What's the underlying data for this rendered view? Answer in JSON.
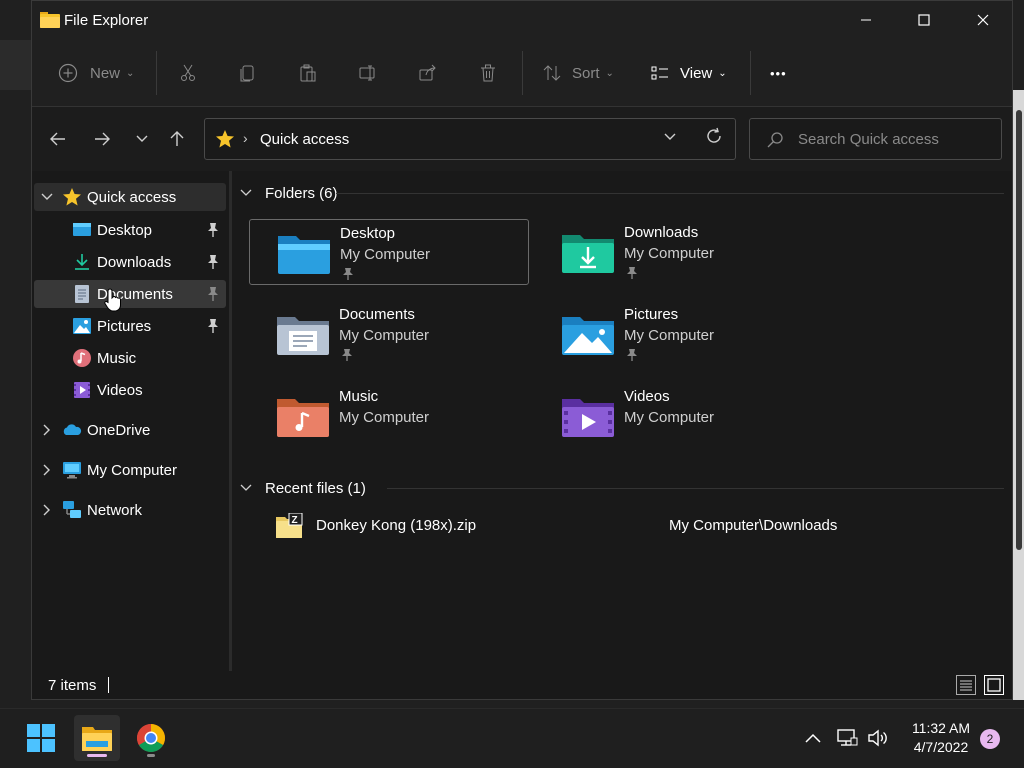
{
  "window": {
    "title": "File Explorer",
    "controls": {
      "minimize": "—",
      "maximize": "☐",
      "close": "✕"
    }
  },
  "toolbar": {
    "new_label": "New",
    "sort_label": "Sort",
    "view_label": "View",
    "more_label": "•••"
  },
  "address": {
    "path": "Quick access",
    "separator": "›"
  },
  "search": {
    "placeholder": "Search Quick access"
  },
  "sidebar": {
    "quick_access": "Quick access",
    "items": [
      {
        "label": "Desktop",
        "pinned": true,
        "icon": "desktop-icon"
      },
      {
        "label": "Downloads",
        "pinned": true,
        "icon": "downloads-icon"
      },
      {
        "label": "Documents",
        "pinned": true,
        "icon": "documents-icon"
      },
      {
        "label": "Pictures",
        "pinned": true,
        "icon": "pictures-icon"
      },
      {
        "label": "Music",
        "pinned": false,
        "icon": "music-icon"
      },
      {
        "label": "Videos",
        "pinned": false,
        "icon": "videos-icon"
      }
    ],
    "roots": [
      {
        "label": "OneDrive",
        "icon": "onedrive-icon"
      },
      {
        "label": "My Computer",
        "icon": "computer-icon"
      },
      {
        "label": "Network",
        "icon": "network-icon"
      }
    ]
  },
  "content": {
    "folders_heading": "Folders (6)",
    "folders": [
      {
        "name": "Desktop",
        "location": "My Computer",
        "pinned": true
      },
      {
        "name": "Downloads",
        "location": "My Computer",
        "pinned": true
      },
      {
        "name": "Documents",
        "location": "My Computer",
        "pinned": true
      },
      {
        "name": "Pictures",
        "location": "My Computer",
        "pinned": true
      },
      {
        "name": "Music",
        "location": "My Computer",
        "pinned": false
      },
      {
        "name": "Videos",
        "location": "My Computer",
        "pinned": false
      }
    ],
    "recent_heading": "Recent files (1)",
    "recent": [
      {
        "name": "Donkey Kong (198x).zip",
        "location": "My Computer\\Downloads"
      }
    ]
  },
  "status": {
    "items": "7 items"
  },
  "taskbar": {
    "time": "11:32 AM",
    "date": "4/7/2022",
    "notifications": "2"
  },
  "colors": {
    "accent": "#60cdff",
    "star": "#f7c42b",
    "folder_blue": "#2a9fe0",
    "folder_teal": "#1fa88f",
    "folder_gray": "#8da0b8",
    "folder_orange": "#f08a5a",
    "folder_purple": "#8b5cd6"
  }
}
